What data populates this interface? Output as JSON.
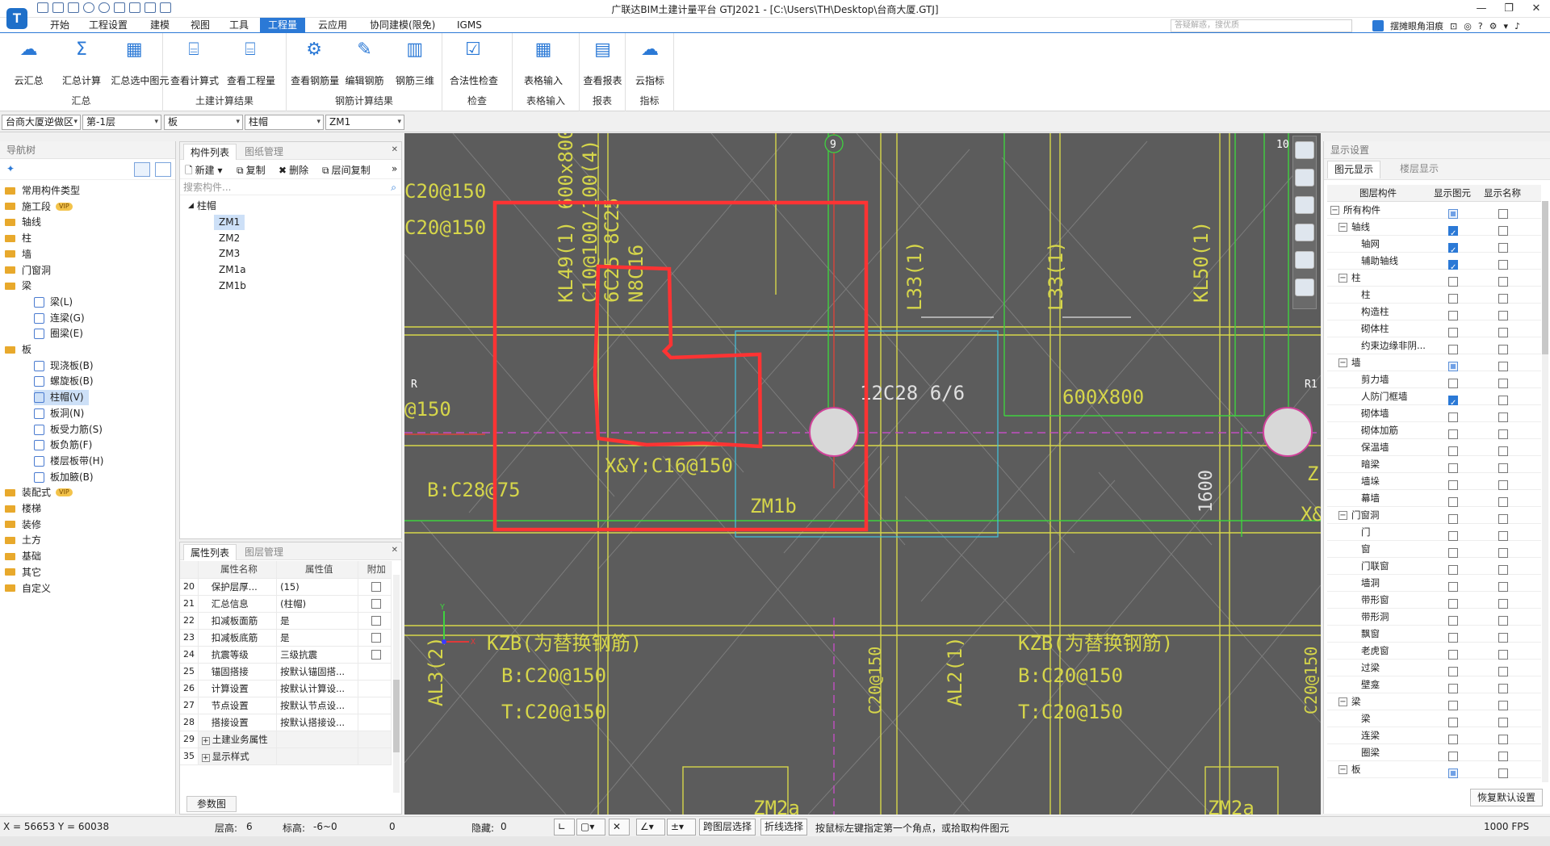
{
  "app": {
    "title": "广联达BIM土建计量平台 GTJ2021 - [C:\\Users\\TH\\Desktop\\台商大厦.GTJ]",
    "logo": "T",
    "search_placeholder": "答疑解惑，搜优质",
    "user": "摆摊眼角泪痕"
  },
  "menu": [
    "开始",
    "工程设置",
    "建模",
    "视图",
    "工具",
    "工程量",
    "云应用",
    "协同建模(限免)",
    "IGMS"
  ],
  "menu_active": "工程量",
  "ribbon": {
    "groups": [
      {
        "label": "汇总",
        "buttons": [
          "云汇总",
          "汇总计算",
          "汇总选中图元"
        ]
      },
      {
        "label": "土建计算结果",
        "buttons": [
          "查看计算式",
          "查看工程量"
        ]
      },
      {
        "label": "钢筋计算结果",
        "buttons": [
          "查看钢筋量",
          "编辑钢筋",
          "钢筋三维"
        ]
      },
      {
        "label": "检查",
        "buttons": [
          "合法性检查"
        ]
      },
      {
        "label": "表格输入",
        "buttons": [
          "表格输入"
        ]
      },
      {
        "label": "报表",
        "buttons": [
          "查看报表"
        ]
      },
      {
        "label": "指标",
        "buttons": [
          "云指标"
        ]
      }
    ]
  },
  "combos": [
    "台商大厦逆做区",
    "第-1层",
    "板",
    "柱帽",
    "ZM1"
  ],
  "nav": {
    "title": "导航树",
    "tree": [
      {
        "label": "常用构件类型",
        "vip": false
      },
      {
        "label": "施工段",
        "vip": true
      },
      {
        "label": "轴线",
        "vip": false
      },
      {
        "label": "柱",
        "vip": false
      },
      {
        "label": "墙",
        "vip": false
      },
      {
        "label": "门窗洞",
        "vip": false
      },
      {
        "label": "梁",
        "vip": false
      }
    ],
    "beam_children": [
      "梁(L)",
      "连梁(G)",
      "圈梁(E)"
    ],
    "slab": "板",
    "slab_children": [
      "现浇板(B)",
      "螺旋板(B)",
      "柱帽(V)",
      "板洞(N)",
      "板受力筋(S)",
      "板负筋(F)",
      "楼层板带(H)",
      "板加腋(B)"
    ],
    "rest": [
      {
        "label": "装配式",
        "vip": true
      },
      {
        "label": "楼梯",
        "vip": false
      },
      {
        "label": "装修",
        "vip": false
      },
      {
        "label": "土方",
        "vip": false
      },
      {
        "label": "基础",
        "vip": false
      },
      {
        "label": "其它",
        "vip": false
      },
      {
        "label": "自定义",
        "vip": false
      }
    ],
    "vip_label": "VIP"
  },
  "complist": {
    "tabs": [
      "构件列表",
      "图纸管理"
    ],
    "tools": [
      "新建",
      "复制",
      "删除",
      "层间复制"
    ],
    "search_placeholder": "搜索构件...",
    "group": "柱帽",
    "items": [
      "ZM1",
      "ZM2",
      "ZM3",
      "ZM1a",
      "ZM1b"
    ],
    "selected": "ZM1"
  },
  "props": {
    "tabs": [
      "属性列表",
      "图层管理"
    ],
    "headers": [
      "属性名称",
      "属性值",
      "附加"
    ],
    "rows": [
      {
        "no": "20",
        "name": "保护层厚...",
        "value": "(15)",
        "check": true
      },
      {
        "no": "21",
        "name": "汇总信息",
        "value": "(柱帽)",
        "check": true
      },
      {
        "no": "22",
        "name": "扣减板面筋",
        "value": "是",
        "check": true
      },
      {
        "no": "23",
        "name": "扣减板底筋",
        "value": "是",
        "check": true
      },
      {
        "no": "24",
        "name": "抗震等级",
        "value": "三级抗震",
        "check": true
      },
      {
        "no": "25",
        "name": "锚固搭接",
        "value": "按默认锚固搭...",
        "check": false
      },
      {
        "no": "26",
        "name": "计算设置",
        "value": "按默认计算设...",
        "check": false
      },
      {
        "no": "27",
        "name": "节点设置",
        "value": "按默认节点设...",
        "check": false
      },
      {
        "no": "28",
        "name": "搭接设置",
        "value": "按默认搭接设...",
        "check": false
      },
      {
        "no": "29",
        "name": "土建业务属性",
        "value": "",
        "check": false
      },
      {
        "no": "35",
        "name": "显示样式",
        "value": "",
        "check": false
      }
    ],
    "params_button": "参数图"
  },
  "canvas": {
    "labels": [
      "9",
      "10",
      "R",
      "R1",
      "B:C28@75",
      "X&Y:C16@150",
      "ZM1b",
      "12C28 6/6",
      "600X800",
      "L33(1)",
      "KL50(1)",
      "KL49(1) 600x800",
      "C10@100/100(4)",
      "6C25 8C25",
      "N8C16",
      "KZB(为替换钢筋)",
      "B:C20@150",
      "T:C20@150",
      "AL3(2)",
      "AL2(1)",
      "1600",
      "ZM2a",
      "C20@150",
      "@150",
      "Z",
      "X&"
    ]
  },
  "display": {
    "title": "显示设置",
    "tabs": [
      "图元显示",
      "楼层显示"
    ],
    "headers": [
      "图层构件",
      "显示图元",
      "显示名称"
    ],
    "rows": [
      {
        "name": "所有构件",
        "level": 0,
        "toggle": true,
        "s1": "part",
        "s2": "off"
      },
      {
        "name": "轴线",
        "level": 1,
        "toggle": true,
        "s1": "on",
        "s2": "off"
      },
      {
        "name": "轴网",
        "level": 2,
        "toggle": false,
        "s1": "on",
        "s2": "off"
      },
      {
        "name": "辅助轴线",
        "level": 2,
        "toggle": false,
        "s1": "on",
        "s2": "off"
      },
      {
        "name": "柱",
        "level": 1,
        "toggle": true,
        "s1": "off",
        "s2": "off"
      },
      {
        "name": "柱",
        "level": 2,
        "toggle": false,
        "s1": "off",
        "s2": "off"
      },
      {
        "name": "构造柱",
        "level": 2,
        "toggle": false,
        "s1": "off",
        "s2": "off"
      },
      {
        "name": "砌体柱",
        "level": 2,
        "toggle": false,
        "s1": "off",
        "s2": "off"
      },
      {
        "name": "约束边缘非阴...",
        "level": 2,
        "toggle": false,
        "s1": "off",
        "s2": "off"
      },
      {
        "name": "墙",
        "level": 1,
        "toggle": true,
        "s1": "part",
        "s2": "off"
      },
      {
        "name": "剪力墙",
        "level": 2,
        "toggle": false,
        "s1": "off",
        "s2": "off"
      },
      {
        "name": "人防门框墙",
        "level": 2,
        "toggle": false,
        "s1": "on",
        "s2": "off"
      },
      {
        "name": "砌体墙",
        "level": 2,
        "toggle": false,
        "s1": "off",
        "s2": "off"
      },
      {
        "name": "砌体加筋",
        "level": 2,
        "toggle": false,
        "s1": "off",
        "s2": "off"
      },
      {
        "name": "保温墙",
        "level": 2,
        "toggle": false,
        "s1": "off",
        "s2": "off"
      },
      {
        "name": "暗梁",
        "level": 2,
        "toggle": false,
        "s1": "off",
        "s2": "off"
      },
      {
        "name": "墙垛",
        "level": 2,
        "toggle": false,
        "s1": "off",
        "s2": "off"
      },
      {
        "name": "幕墙",
        "level": 2,
        "toggle": false,
        "s1": "off",
        "s2": "off"
      },
      {
        "name": "门窗洞",
        "level": 1,
        "toggle": true,
        "s1": "off",
        "s2": "off"
      },
      {
        "name": "门",
        "level": 2,
        "toggle": false,
        "s1": "off",
        "s2": "off"
      },
      {
        "name": "窗",
        "level": 2,
        "toggle": false,
        "s1": "off",
        "s2": "off"
      },
      {
        "name": "门联窗",
        "level": 2,
        "toggle": false,
        "s1": "off",
        "s2": "off"
      },
      {
        "name": "墙洞",
        "level": 2,
        "toggle": false,
        "s1": "off",
        "s2": "off"
      },
      {
        "name": "带形窗",
        "level": 2,
        "toggle": false,
        "s1": "off",
        "s2": "off"
      },
      {
        "name": "带形洞",
        "level": 2,
        "toggle": false,
        "s1": "off",
        "s2": "off"
      },
      {
        "name": "飘窗",
        "level": 2,
        "toggle": false,
        "s1": "off",
        "s2": "off"
      },
      {
        "name": "老虎窗",
        "level": 2,
        "toggle": false,
        "s1": "off",
        "s2": "off"
      },
      {
        "name": "过梁",
        "level": 2,
        "toggle": false,
        "s1": "off",
        "s2": "off"
      },
      {
        "name": "壁龛",
        "level": 2,
        "toggle": false,
        "s1": "off",
        "s2": "off"
      },
      {
        "name": "梁",
        "level": 1,
        "toggle": true,
        "s1": "off",
        "s2": "off"
      },
      {
        "name": "梁",
        "level": 2,
        "toggle": false,
        "s1": "off",
        "s2": "off"
      },
      {
        "name": "连梁",
        "level": 2,
        "toggle": false,
        "s1": "off",
        "s2": "off"
      },
      {
        "name": "圈梁",
        "level": 2,
        "toggle": false,
        "s1": "off",
        "s2": "off"
      },
      {
        "name": "板",
        "level": 1,
        "toggle": true,
        "s1": "part",
        "s2": "off"
      }
    ],
    "restore_button": "恢复默认设置"
  },
  "status": {
    "coords": "X = 56653 Y = 60038",
    "floor_height_label": "层高:",
    "floor_height": "6",
    "elevation_label": "标高:",
    "elevation": "-6~0",
    "count": "0",
    "hidden_label": "隐藏:",
    "hidden": "0",
    "btn_cross_layer": "跨图层选择",
    "btn_polyline": "折线选择",
    "hint": "按鼠标左键指定第一个角点，或拾取构件图元",
    "fps": "1000 FPS"
  },
  "colors": {
    "accent": "#2b79d6",
    "canvas_bg": "#5c5c5c",
    "cad_yellow": "#d6d64a",
    "cad_green": "#3fd23f",
    "annotation_red": "#ff3333"
  }
}
